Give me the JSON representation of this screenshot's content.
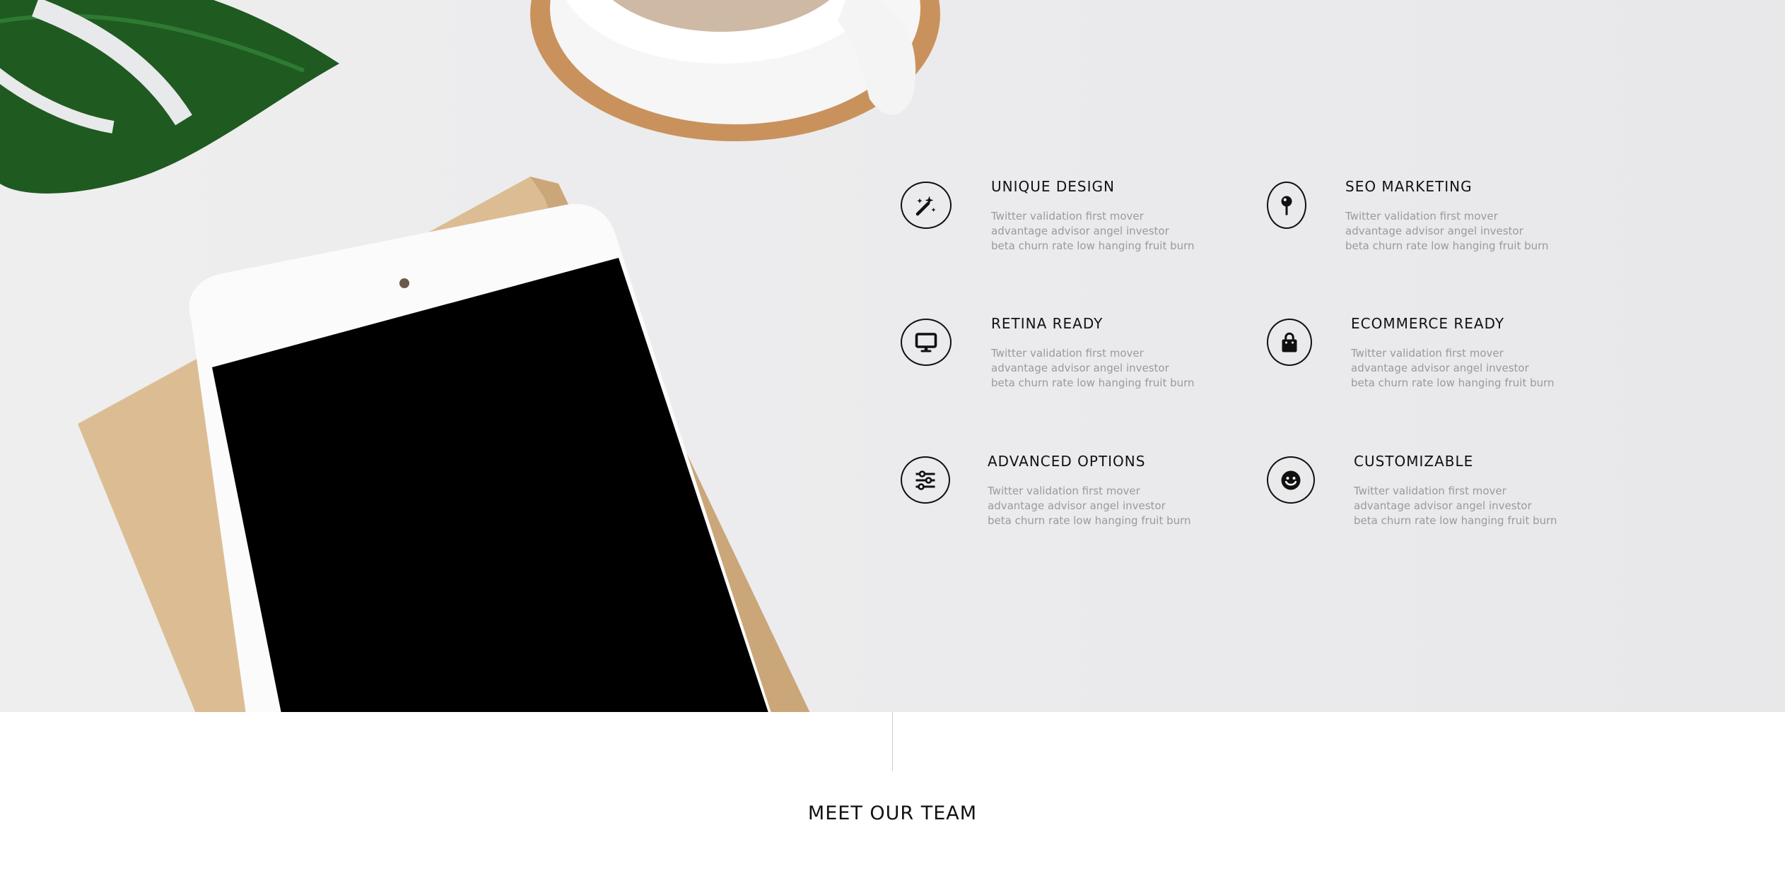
{
  "features": [
    {
      "title": "UNIQUE DESIGN",
      "description": "Twitter validation first mover advantage advisor angel investor beta churn rate low hanging fruit burn",
      "icon": "magic-wand-icon"
    },
    {
      "title": "SEO MARKETING",
      "description": "Twitter validation first mover advantage advisor angel investor beta churn rate low hanging fruit burn",
      "icon": "map-pin-icon"
    },
    {
      "title": "RETINA READY",
      "description": "Twitter validation first mover advantage advisor angel investor beta churn rate low hanging fruit burn",
      "icon": "monitor-icon"
    },
    {
      "title": "ECOMMERCE READY",
      "description": "Twitter validation first mover advantage advisor angel investor beta churn rate low hanging fruit burn",
      "icon": "shopping-bag-icon"
    },
    {
      "title": "ADVANCED OPTIONS",
      "description": "Twitter validation first mover advantage advisor angel investor beta churn rate low hanging fruit burn",
      "icon": "sliders-icon"
    },
    {
      "title": "CUSTOMIZABLE",
      "description": "Twitter validation first mover advantage advisor angel investor beta churn rate low hanging fruit burn",
      "icon": "smiley-icon"
    }
  ],
  "team_section": {
    "title": "MEET OUR TEAM"
  }
}
